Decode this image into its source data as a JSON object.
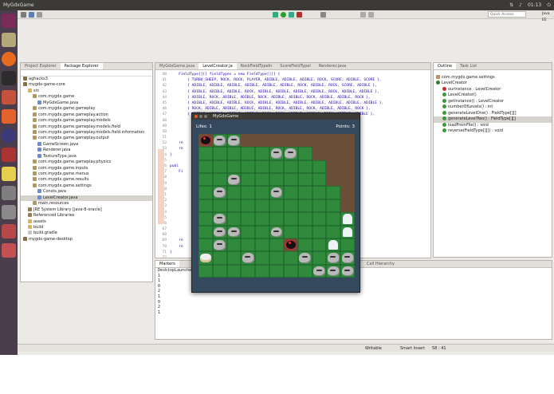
{
  "topbar": {
    "title": "MyGdxGame",
    "clock": "01:13"
  },
  "launcher": [
    "search-icon",
    "files-icon",
    "firefox-icon",
    "terminal-icon",
    "eclipse-icon",
    "software-icon",
    "amazon-icon",
    "settings-icon",
    "trash-icon"
  ],
  "toolbar": {
    "quick_access": "Quick Access",
    "perspective": "Java EE"
  },
  "explorer": {
    "tabs": [
      "Project Explorer",
      "Package Explorer"
    ],
    "items": [
      {
        "label": "aghacks3",
        "icon": "proj",
        "indent": 0
      },
      {
        "label": "mygdx-game-core",
        "icon": "proj",
        "indent": 0
      },
      {
        "label": "src",
        "icon": "folder",
        "indent": 1
      },
      {
        "label": "com.mygdx.game",
        "icon": "pkg",
        "indent": 2
      },
      {
        "label": "MyGdxGame.java",
        "icon": "java",
        "indent": 3
      },
      {
        "label": "com.mygdx.game.gameplay",
        "icon": "pkg",
        "indent": 2
      },
      {
        "label": "com.mygdx.game.gameplay.action",
        "icon": "pkg",
        "indent": 2
      },
      {
        "label": "com.mygdx.game.gameplay.models",
        "icon": "pkg",
        "indent": 2
      },
      {
        "label": "com.mygdx.game.gameplay.models.field",
        "icon": "pkg",
        "indent": 2
      },
      {
        "label": "com.mygdx.game.gameplay.models.field.information",
        "icon": "pkg",
        "indent": 2
      },
      {
        "label": "com.mygdx.game.gameplay.output",
        "icon": "pkg",
        "indent": 2
      },
      {
        "label": "GameScreen.java",
        "icon": "java",
        "indent": 3
      },
      {
        "label": "Renderer.java",
        "icon": "java",
        "indent": 3
      },
      {
        "label": "TextureType.java",
        "icon": "java",
        "indent": 3
      },
      {
        "label": "com.mygdx.game.gameplay.physics",
        "icon": "pkg",
        "indent": 2
      },
      {
        "label": "com.mygdx.game.inputs",
        "icon": "pkg",
        "indent": 2
      },
      {
        "label": "com.mygdx.game.menus",
        "icon": "pkg",
        "indent": 2
      },
      {
        "label": "com.mygdx.game.results",
        "icon": "pkg",
        "indent": 2
      },
      {
        "label": "com.mygdx.game.settings",
        "icon": "pkg",
        "indent": 2
      },
      {
        "label": "Consts.java",
        "icon": "java",
        "indent": 3
      },
      {
        "label": "LevelCreator.java",
        "icon": "java",
        "indent": 3,
        "selected": true
      },
      {
        "label": "main.resources",
        "icon": "pkg",
        "indent": 2
      },
      {
        "label": "JRE System Library [java-8-oracle]",
        "icon": "lib",
        "indent": 1
      },
      {
        "label": "Referenced Libraries",
        "icon": "lib",
        "indent": 1
      },
      {
        "label": "assets",
        "icon": "folder",
        "indent": 1
      },
      {
        "label": "build",
        "icon": "folder",
        "indent": 1
      },
      {
        "label": "build.gradle",
        "icon": "file",
        "indent": 1
      },
      {
        "label": "mygdx-game-desktop",
        "icon": "proj",
        "indent": 0
      }
    ]
  },
  "editor": {
    "tabs": [
      "MyGdxGame.java",
      "LevelCreator.ja",
      "RockFieldTypeIn",
      "ScoreFieldTypeI",
      "Renderer.java"
    ],
    "lines": [
      {
        "n": "40",
        "text": "    FieldType[][] fieldTypes = new FieldType[][] {"
      },
      {
        "n": "41",
        "text": "        { TURBO_SHEEP, ROCK, ROCK, PLAYER, ADIBLE, ADIBLE, ADIBLE, ROCK, SCORE, ADIBLE, SCORE },"
      },
      {
        "n": "42",
        "text": "        { ADIBLE, ADIBLE, ADIBLE, ADIBLE, ADIBLE, ADIBLE, ROCK, ADIBLE, ROCK, SCORE, ADIBLE },"
      },
      {
        "n": "43",
        "text": "        { ADIBLE, ADIBLE, ADIBLE, ROCK, ADIBLE, ADIBLE, ADIBLE, ADIBLE, ROCK, ADIBLE, ADIBLE },"
      },
      {
        "n": "44",
        "text": "        { ADIBLE, ROCK, ADIBLE, ADIBLE, ROCK, ADIBLE, ADIBLE, ROCK, ADIBLE, ADIBLE, ROCK },"
      },
      {
        "n": "45",
        "text": "        { ADIBLE, ADIBLE, ADIBLE, ROCK, ADIBLE, ADIBLE, ADIBLE, ADIBLE, ADIBLE, ADIBLE, ADIBLE },"
      },
      {
        "n": "46",
        "text": "        { ROCK, ADIBLE, ADIBLE, ADIBLE, ADIBLE, ROCK, ADIBLE, ROCK, ADIBLE, ADIBLE, ROCK },"
      },
      {
        "n": "47",
        "text": "        { ADIBLE, ADIBLE, ADIBLE, ADIBLE, ROCK, ROCK, ADIBLE, ADIBLE, ROCK, ADIBLE, ADIBLE },"
      },
      {
        "n": "48",
        "text": "                                         ADIBLE, ADIBLE },"
      },
      {
        "n": "49",
        "text": "                                         ADIBLE, ROCK },"
      },
      {
        "n": "50",
        "text": "                                         ADIBLE, ADIBLE } };"
      },
      {
        "n": "51",
        "text": ""
      },
      {
        "n": "52",
        "text": "    re"
      },
      {
        "n": "53",
        "text": "    re"
      },
      {
        "n": "54",
        "text": "}"
      },
      {
        "n": "55",
        "text": ""
      },
      {
        "n": "56",
        "text": "publ"
      },
      {
        "n": "57",
        "text": "    Fi"
      },
      {
        "n": "58",
        "text": ""
      },
      {
        "n": "59",
        "text": "                                 ADIBLE, ADIBLE, SCORE },"
      },
      {
        "n": "60",
        "text": "                                 ADIBLE },"
      },
      {
        "n": "61",
        "text": "                                 ADIBLE, ROCK, ADIBLE },"
      },
      {
        "n": "62",
        "text": "                                 ADIBLE, ADIBLE },"
      },
      {
        "n": "63",
        "text": "                                 ADIBLE },"
      },
      {
        "n": "64",
        "text": "                                 ADIBLE, SCORE },"
      },
      {
        "n": "65",
        "text": "                                 ADIBLE, SCORE },"
      },
      {
        "n": "66",
        "text": "                                 ADIBLE, ADIBLE },"
      },
      {
        "n": "67",
        "text": "                                 ADIBLE, ROCK },"
      },
      {
        "n": "68",
        "text": "                                 ADIBLE, ADIBLE } };"
      },
      {
        "n": "69",
        "text": "    re"
      },
      {
        "n": "70",
        "text": "    re"
      },
      {
        "n": "71",
        "text": "}"
      },
      {
        "n": "72",
        "text": ""
      },
      {
        "n": "73",
        "text": "publ"
      },
      {
        "n": "74",
        "text": "    St"
      },
      {
        "n": "75",
        "text": "    St"
      },
      {
        "n": "76",
        "text": "    Fi"
      }
    ]
  },
  "outline": {
    "tabs": [
      "Outline",
      "Task List"
    ],
    "items": [
      {
        "label": "com.mygdx.game.settings",
        "icon": "pkg",
        "indent": 0
      },
      {
        "label": "LevelCreator",
        "icon": "cls",
        "indent": 0
      },
      {
        "label": "ourInstance : LevelCreator",
        "icon": "f",
        "indent": 1
      },
      {
        "label": "LevelCreator()",
        "icon": "m",
        "indent": 1
      },
      {
        "label": "getInstance() : LevelCreator",
        "icon": "m",
        "indent": 1
      },
      {
        "label": "numberOfLevels() : int",
        "icon": "m",
        "indent": 1
      },
      {
        "label": "generateLevelOne() : FieldType[][]",
        "icon": "m",
        "indent": 1
      },
      {
        "label": "generateLevelTwo() : FieldType[][]",
        "icon": "m",
        "indent": 1,
        "selected": true
      },
      {
        "label": "loadFromFile() : void",
        "icon": "m",
        "indent": 1
      },
      {
        "label": "reverse(FieldType[][]) : void",
        "icon": "m",
        "indent": 1
      }
    ]
  },
  "bottom": {
    "tabs": [
      "Markers",
      "Call Hierarchy"
    ],
    "console_title": "DesktopLauncher",
    "lines": [
      "1",
      "1",
      "0",
      "2",
      "1",
      "0",
      "2",
      "1"
    ]
  },
  "status": {
    "writable": "Writable",
    "insert": "Smart Insert",
    "position": "58 : 41"
  },
  "game": {
    "title": "MyGdxGame",
    "lifes": "Lifes: 1",
    "points": "Points: 3",
    "grid": [
      "SRREEEEEEEE",
      "DDDDDRRDEEE",
      "DDDDDDDDDEE",
      "DDRDDDDDDEE",
      "DRDDDRDDDDE",
      "DDDDDDDDDDE",
      "DRDDDDDDDDX",
      "DRRDDRDDDDX",
      "DRDDDDSDDXD",
      "PDDRDDDRDRR",
      "DDDDDDDDRRR"
    ]
  }
}
